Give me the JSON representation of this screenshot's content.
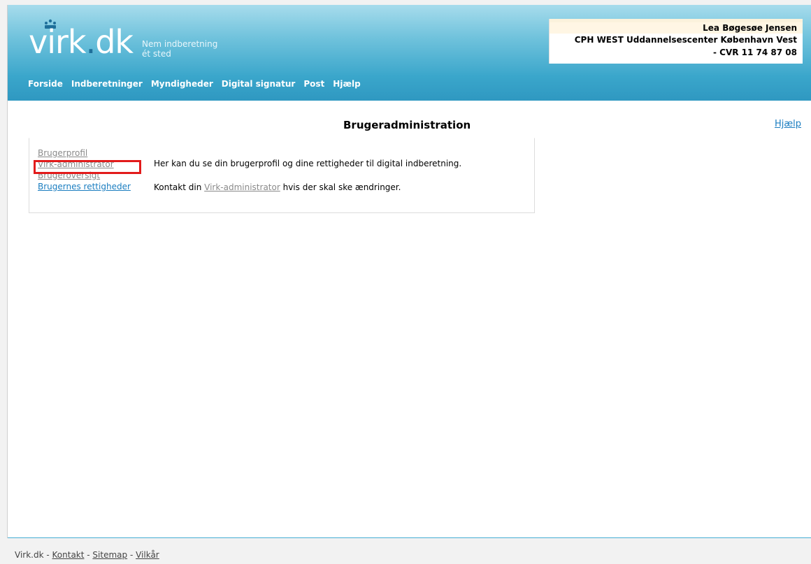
{
  "brand": {
    "logo_main": "virk",
    "logo_dot": ".",
    "logo_tld": "dk",
    "tagline_line1": "Nem indberetning",
    "tagline_line2": "ét sted"
  },
  "user": {
    "name": "Lea Bøgesøe Jensen",
    "org": "CPH WEST Uddannelsescenter København Vest",
    "cvr": "- CVR 11 74 87 08"
  },
  "nav": {
    "items": [
      "Forside",
      "Indberetninger",
      "Myndigheder",
      "Digital signatur",
      "Post",
      "Hjælp"
    ]
  },
  "page": {
    "title": "Brugeradministration",
    "help_link": "Hjælp"
  },
  "sidebar": {
    "items": [
      "Brugerprofil",
      "Virk-administrator",
      "Brugeroversigt",
      "Brugernes rettigheder"
    ],
    "highlighted_item": "Virk-administrator"
  },
  "main": {
    "intro": "Her kan du se din brugerprofil og dine rettigheder til digital indberetning.",
    "contact_prefix": "Kontakt din ",
    "contact_link": "Virk-administrator",
    "contact_suffix": " hvis der skal ske ændringer."
  },
  "footer": {
    "site": "Virk.dk",
    "sep": " - ",
    "links": [
      "Kontakt",
      "Sitemap",
      "Vilkår"
    ]
  },
  "colors": {
    "header_blue": "#3aa6cb",
    "link_blue": "#1a7dc0",
    "highlight_red": "#e21b1b"
  }
}
